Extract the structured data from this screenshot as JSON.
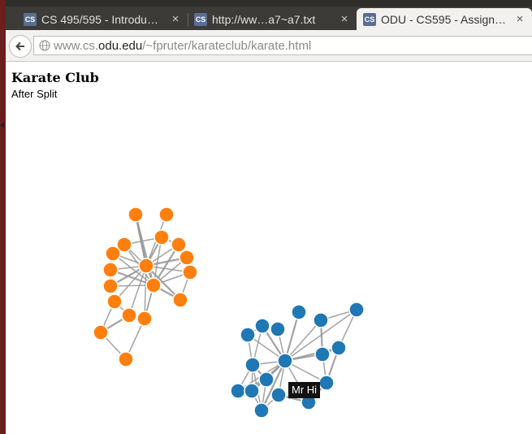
{
  "browser": {
    "tabs": [
      {
        "title": "CS 495/595 - Introdu…",
        "favicon": "odu-favicon",
        "close": "×"
      },
      {
        "title": "http://ww…a7~a7.txt",
        "favicon": "odu-favicon",
        "close": "×"
      },
      {
        "title": "ODU - CS595 - Assign…",
        "favicon": "odu-favicon",
        "close": "×",
        "active": true
      }
    ],
    "url_prefix": "www.cs.",
    "url_host": "odu.edu",
    "url_path": "/~fpruter/karateclub/karate.html"
  },
  "page": {
    "title": "Karate Club",
    "subtitle": "After Split",
    "tooltip": "Mr Hi"
  },
  "colors": {
    "group_a": "#ff7f0e",
    "group_b": "#1f77b4",
    "edge": "#999999"
  },
  "chart_data": {
    "type": "network",
    "title": "Karate Club",
    "subtitle": "After Split",
    "groups": [
      "group_a",
      "group_b"
    ],
    "highlighted_node_label": "Mr Hi"
  }
}
